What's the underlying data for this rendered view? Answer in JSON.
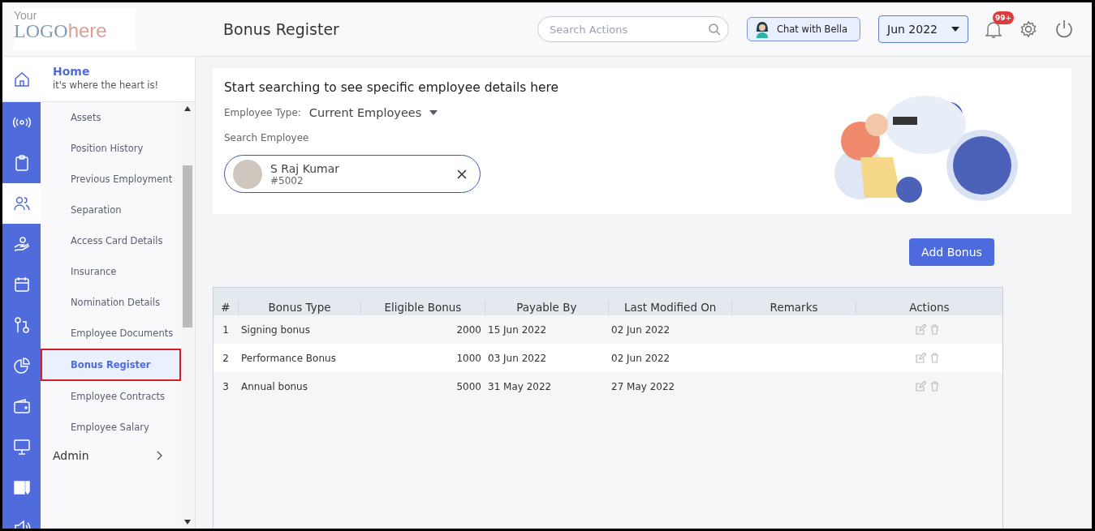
{
  "logo": {
    "top": "Your",
    "main": "LOGO",
    "tail": "here"
  },
  "header": {
    "title": "Bonus Register",
    "search": {
      "placeholder": "Search Actions"
    },
    "chat_button": "Chat with Bella",
    "month": "Jun 2022",
    "notifications": "99+"
  },
  "sidebar": {
    "home": {
      "title": "Home",
      "subtitle": "it's where the heart is!"
    },
    "rail": [
      {
        "kind": "signal",
        "selected": false
      },
      {
        "kind": "clipboard",
        "selected": false
      },
      {
        "kind": "people",
        "selected": true
      },
      {
        "kind": "hand",
        "selected": false
      },
      {
        "kind": "calendar",
        "selected": false
      },
      {
        "kind": "route",
        "selected": false
      },
      {
        "kind": "pie",
        "selected": false
      },
      {
        "kind": "wallet",
        "selected": false
      },
      {
        "kind": "monitor",
        "selected": false
      },
      {
        "kind": "news",
        "selected": false
      },
      {
        "kind": "speaker",
        "selected": false
      }
    ],
    "items": [
      {
        "label": "Assets",
        "selected": false
      },
      {
        "label": "Position History",
        "selected": false
      },
      {
        "label": "Previous Employment",
        "selected": false
      },
      {
        "label": "Separation",
        "selected": false
      },
      {
        "label": "Access Card Details",
        "selected": false
      },
      {
        "label": "Insurance",
        "selected": false
      },
      {
        "label": "Nomination Details",
        "selected": false
      },
      {
        "label": "Employee Documents",
        "selected": false
      },
      {
        "label": "Bonus Register",
        "selected": true
      },
      {
        "label": "Employee Contracts",
        "selected": false
      },
      {
        "label": "Employee Salary",
        "selected": false
      }
    ],
    "admin": "Admin"
  },
  "search_panel": {
    "heading": "Start searching to see specific employee details here",
    "type_label": "Employee Type:",
    "type_value": "Current Employees",
    "search_label": "Search Employee",
    "employee": {
      "name": "S Raj Kumar",
      "id": "#5002"
    }
  },
  "add_button": "Add Bonus",
  "table": {
    "columns": [
      "#",
      "Bonus Type",
      "Eligible Bonus",
      "Payable By",
      "Last Modified On",
      "Remarks",
      "Actions"
    ],
    "rows": [
      {
        "index": "1",
        "type": "Signing bonus",
        "eligible": "2000",
        "payable_by": "15 Jun 2022",
        "modified": "02 Jun 2022"
      },
      {
        "index": "2",
        "type": "Performance Bonus",
        "eligible": "1000",
        "payable_by": "03 Jun 2022",
        "modified": "02 Jun 2022"
      },
      {
        "index": "3",
        "type": "Annual bonus",
        "eligible": "5000",
        "payable_by": "31 May 2022",
        "modified": "27 May 2022"
      }
    ]
  }
}
